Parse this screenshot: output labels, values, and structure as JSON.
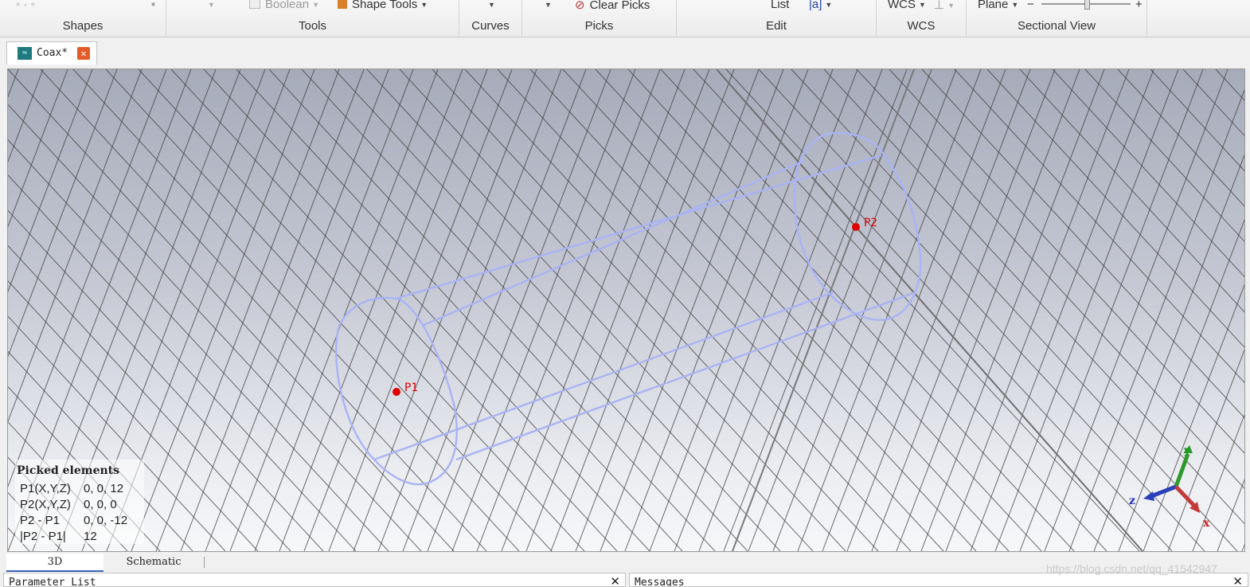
{
  "ribbon": {
    "groups": [
      {
        "label": "Shapes"
      },
      {
        "label": "Tools"
      },
      {
        "label": "Curves"
      },
      {
        "label": "Picks"
      },
      {
        "label": "Edit"
      },
      {
        "label": "WCS"
      },
      {
        "label": "Sectional View"
      }
    ],
    "items": {
      "boolean": "Boolean",
      "shape_tools": "Shape Tools",
      "clear_picks": "Clear Picks",
      "list": "List",
      "wcs": "WCS",
      "plane": "Plane",
      "minus": "−",
      "plus": "+"
    }
  },
  "document_tab": {
    "label": "Coax*",
    "icon": "coax-project-icon",
    "close_icon": "close-icon"
  },
  "viewport": {
    "points": [
      {
        "label": "P1",
        "color": "#e00000"
      },
      {
        "label": "P2",
        "color": "#e00000"
      }
    ],
    "axes": {
      "x": "x",
      "y": "y",
      "z": "z"
    },
    "picked_elements": {
      "title": "Picked elements",
      "rows": [
        {
          "key": "P1(X,Y,Z)",
          "value": "0, 0, 12"
        },
        {
          "key": "P2(X,Y,Z)",
          "value": "0, 0, 0"
        },
        {
          "key": "P2 - P1",
          "value": "0, 0, -12"
        },
        {
          "key": "|P2 - P1|",
          "value": "12"
        }
      ]
    },
    "shape_color": "#a9b3f5"
  },
  "view_tabs": [
    {
      "label": "3D",
      "active": true
    },
    {
      "label": "Schematic",
      "active": false
    }
  ],
  "panels": {
    "parameter_list": {
      "title": "Parameter List"
    },
    "messages": {
      "title": "Messages"
    }
  },
  "watermark": "https://blog.csdn.net/qq_41542947"
}
